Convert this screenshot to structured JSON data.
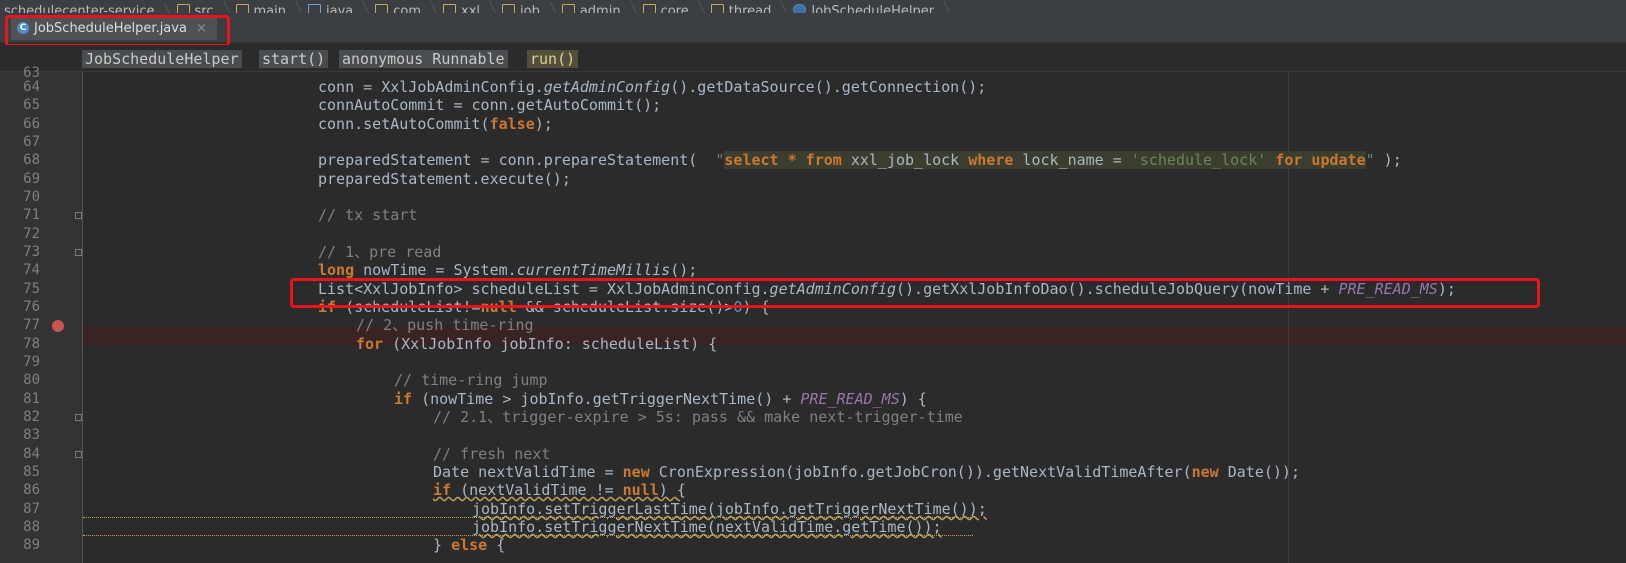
{
  "breadcrumbs": [
    "schedulecenter-service",
    "src",
    "main",
    "java",
    "com",
    "xxl",
    "job",
    "admin",
    "core",
    "thread",
    "JobScheduleHelper"
  ],
  "tab": {
    "label": "JobScheduleHelper.java",
    "close": "×",
    "icon": "C"
  },
  "nav": [
    "JobScheduleHelper",
    "start()",
    "anonymous Runnable",
    "run()"
  ],
  "lines": {
    "n63": "63",
    "n64": "64",
    "n65": "65",
    "n66": "66",
    "n67": "67",
    "n68": "68",
    "n69": "69",
    "n70": "70",
    "n71": "71",
    "n72": "72",
    "n73": "73",
    "n74": "74",
    "n75": "75",
    "n76": "76",
    "n77": "77",
    "n78": "78",
    "n79": "79",
    "n80": "80",
    "n81": "81",
    "n82": "82",
    "n83": "83",
    "n84": "84",
    "n85": "85",
    "n86": "86",
    "n87": "87",
    "n88": "88",
    "n89": "89"
  },
  "code": {
    "l64a": "conn = XxlJobAdminConfig.",
    "l64b": "getAdminConfig",
    "l64c": "().getDataSource().getConnection();",
    "l65": "connAutoCommit = conn.getAutoCommit();",
    "l66a": "conn.setAutoCommit(",
    "l66b": "false",
    "l66c": ");",
    "l68a": "preparedStatement = conn.prepareStatement(  ",
    "l68q1": "\"",
    "l68k1": "select * from",
    "l68s1": " xxl_job_lock ",
    "l68k2": "where",
    "l68s2": " lock_name = ",
    "l68v": "'schedule_lock'",
    "l68s3": " ",
    "l68k3": "for update",
    "l68q2": "\"",
    "l68e": " );",
    "l69": "preparedStatement.execute();",
    "l71": "// tx start",
    "l73": "// 1、pre read",
    "l74a": "long",
    "l74b": " nowTime = System.",
    "l74c": "currentTimeMillis",
    "l74d": "();",
    "l75a": "List<XxlJobInfo> scheduleList = XxlJobAdminConfig.",
    "l75b": "getAdminConfig",
    "l75c": "().getXxlJobInfoDao().scheduleJobQuery(nowTime + ",
    "l75d": "PRE_READ_MS",
    "l75e": ");",
    "l76a": "if",
    "l76b": " (scheduleList!=",
    "l76c": "null",
    "l76d": " && scheduleList.size()>",
    "l76e": "0",
    "l76f": ") {",
    "l77": "// 2、push time-ring",
    "l78a": "for",
    "l78b": " (XxlJobInfo jobInfo: scheduleList) {",
    "l80": "// time-ring jump",
    "l81a": "if",
    "l81b": " (nowTime > jobInfo.getTriggerNextTime() + ",
    "l81c": "PRE_READ_MS",
    "l81d": ") {",
    "l82": "// 2.1、trigger-expire > 5s: pass && make next-trigger-time",
    "l84": "// fresh next",
    "l85a": "Date nextValidTime = ",
    "l85b": "new",
    "l85c": " CronExpression(jobInfo.getJobCron()).getNextValidTimeAfter(",
    "l85d": "new",
    "l85e": " Date());",
    "l86a": "if",
    "l86b": " (nextValidTime != ",
    "l86c": "null",
    "l86d": ") {",
    "l87": "jobInfo.setTriggerLastTime(jobInfo.getTriggerNextTime());",
    "l88": "jobInfo.setTriggerNextTime(nextValidTime.getTime());",
    "l89a": "} ",
    "l89b": "else",
    "l89c": " {"
  }
}
